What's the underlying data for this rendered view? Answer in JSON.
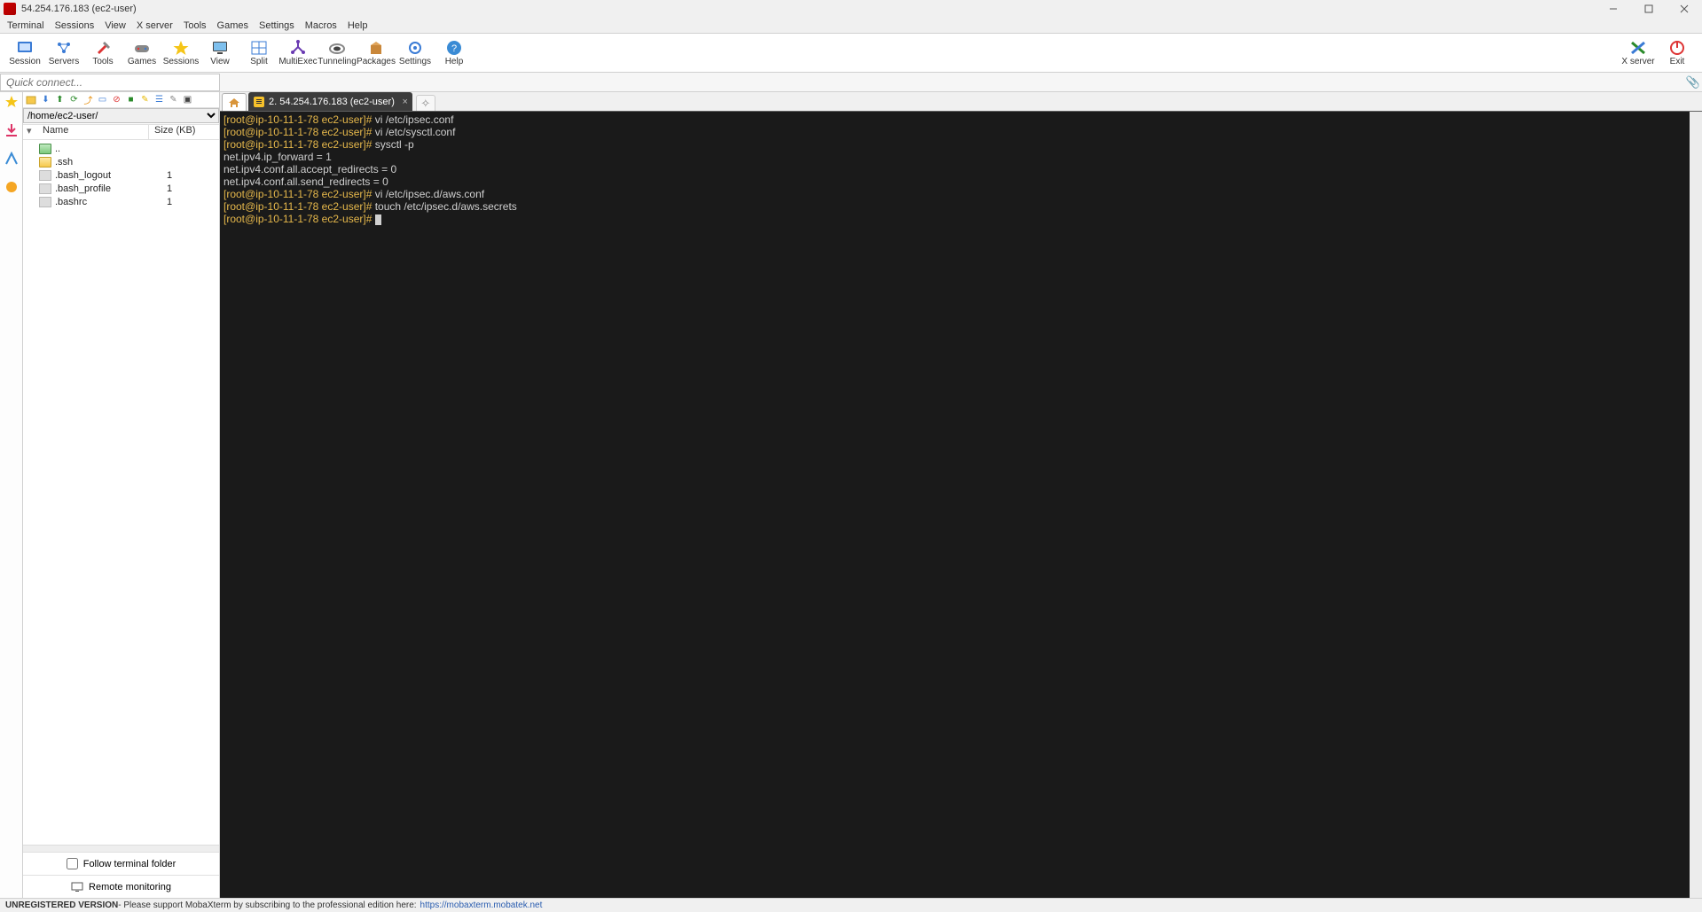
{
  "window_title": "54.254.176.183 (ec2-user)",
  "menu": [
    "Terminal",
    "Sessions",
    "View",
    "X server",
    "Tools",
    "Games",
    "Settings",
    "Macros",
    "Help"
  ],
  "toolbar": [
    {
      "label": "Session",
      "icon": "session-icon"
    },
    {
      "label": "Servers",
      "icon": "servers-icon"
    },
    {
      "label": "Tools",
      "icon": "tools-icon"
    },
    {
      "label": "Games",
      "icon": "games-icon"
    },
    {
      "label": "Sessions",
      "icon": "star-icon"
    },
    {
      "label": "View",
      "icon": "view-icon"
    },
    {
      "label": "Split",
      "icon": "split-icon"
    },
    {
      "label": "MultiExec",
      "icon": "multiexec-icon"
    },
    {
      "label": "Tunneling",
      "icon": "tunneling-icon"
    },
    {
      "label": "Packages",
      "icon": "packages-icon"
    },
    {
      "label": "Settings",
      "icon": "settings-icon"
    },
    {
      "label": "Help",
      "icon": "help-icon"
    }
  ],
  "toolbar_right": [
    {
      "label": "X server",
      "icon": "xserver-icon"
    },
    {
      "label": "Exit",
      "icon": "exit-icon"
    }
  ],
  "quickconnect_placeholder": "Quick connect...",
  "sidebar": {
    "path": "/home/ec2-user/",
    "columns": {
      "name": "Name",
      "size": "Size (KB)"
    },
    "files": [
      {
        "name": "..",
        "size": "",
        "type": "up"
      },
      {
        "name": ".ssh",
        "size": "",
        "type": "folder"
      },
      {
        "name": ".bash_logout",
        "size": "1",
        "type": "file"
      },
      {
        "name": ".bash_profile",
        "size": "1",
        "type": "file"
      },
      {
        "name": ".bashrc",
        "size": "1",
        "type": "file"
      }
    ],
    "follow_label": "Follow terminal folder",
    "remote_label": "Remote monitoring"
  },
  "tab_label": "2. 54.254.176.183 (ec2-user)",
  "terminal_lines": [
    {
      "prompt": "[root@ip-10-11-1-78 ec2-user]#",
      "cmd": " vi /etc/ipsec.conf"
    },
    {
      "prompt": "[root@ip-10-11-1-78 ec2-user]#",
      "cmd": " vi /etc/sysctl.conf"
    },
    {
      "prompt": "[root@ip-10-11-1-78 ec2-user]#",
      "cmd": " sysctl -p"
    },
    {
      "out": "net.ipv4.ip_forward = 1"
    },
    {
      "out": "net.ipv4.conf.all.accept_redirects = 0"
    },
    {
      "out": "net.ipv4.conf.all.send_redirects = 0"
    },
    {
      "prompt": "[root@ip-10-11-1-78 ec2-user]#",
      "cmd": " vi /etc/ipsec.d/aws.conf"
    },
    {
      "prompt": "[root@ip-10-11-1-78 ec2-user]#",
      "cmd": " touch /etc/ipsec.d/aws.secrets"
    },
    {
      "prompt": "[root@ip-10-11-1-78 ec2-user]#",
      "cmd": " ",
      "cursor": true
    }
  ],
  "status": {
    "prefix": "UNREGISTERED VERSION",
    "text": " - Please support MobaXterm by subscribing to the professional edition here: ",
    "link": "https://mobaxterm.mobatek.net"
  }
}
